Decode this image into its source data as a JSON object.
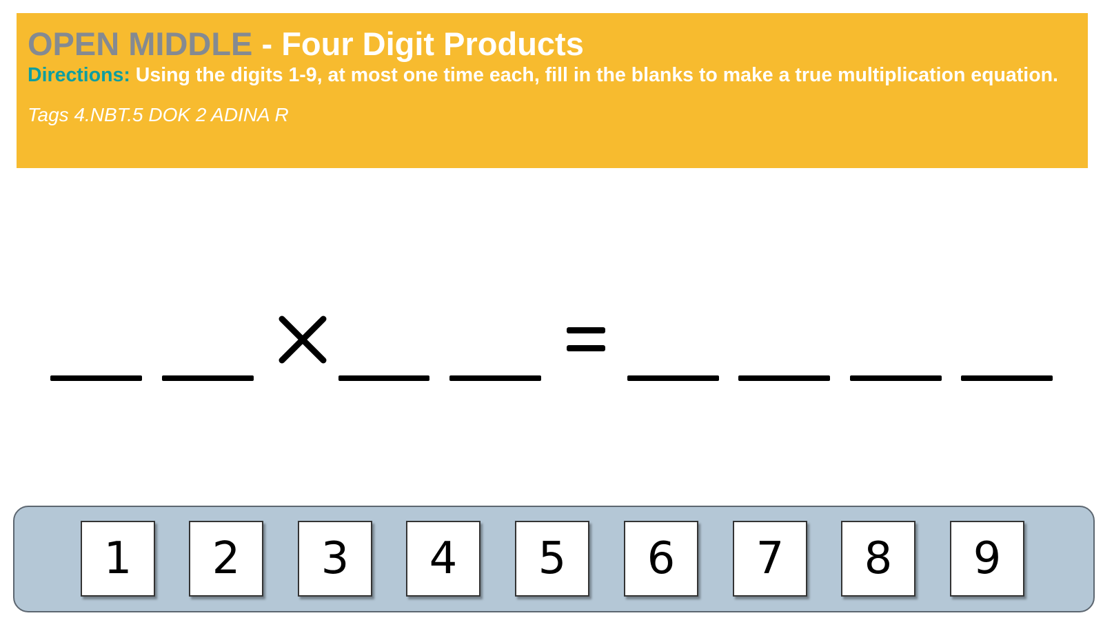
{
  "header": {
    "title_brand": "OPEN MIDDLE",
    "title_rest": " - Four Digit Products",
    "directions_label": "Directions:",
    "directions_text": " Using the digits 1-9, at most one time each, fill in the blanks to make a true multiplication equation.",
    "tags": "Tags 4.NBT.5 DOK 2 ADINA R",
    "colors": {
      "banner": "#f7bb2f",
      "brand": "#848a92",
      "directions_label": "#0e9ea0",
      "text": "#ffffff"
    }
  },
  "equation": {
    "operator_1": "times-icon",
    "operator_2": "equals-icon",
    "first_factor_blanks": 2,
    "second_factor_blanks": 2,
    "product_blanks": 4
  },
  "digit_tray": {
    "tiles": [
      "1",
      "2",
      "3",
      "4",
      "5",
      "6",
      "7",
      "8",
      "9"
    ],
    "colors": {
      "tray": "#b4c7d6",
      "tile": "#ffffff"
    }
  }
}
